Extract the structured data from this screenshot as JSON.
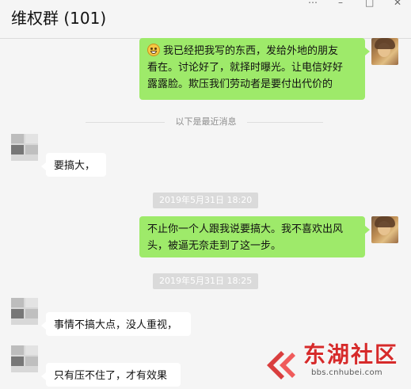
{
  "window": {
    "title": "维权群 (101)"
  },
  "chat": {
    "messages": [
      {
        "side": "self",
        "emoji": "grinning-face",
        "lines": [
          "我已经把我写的东西，发给外地的朋友",
          "看在。讨论好了，就择时曝光。让电信好好",
          "露露脸。欺压我们劳动者是要付出代价的"
        ]
      },
      {
        "type": "divider",
        "text": "以下是最近消息"
      },
      {
        "side": "other",
        "text": "要搞大，"
      },
      {
        "type": "timestamp",
        "text": "2019年5月31日 18:20"
      },
      {
        "side": "self",
        "lines": [
          "不止你一个人跟我说要搞大。我不喜欢出风",
          "头，被逼无奈走到了这一步。"
        ]
      },
      {
        "type": "timestamp",
        "text": "2019年5月31日 18:25"
      },
      {
        "side": "other",
        "text": "事情不搞大点，没人重视，"
      },
      {
        "side": "other",
        "text": "只有压不住了，才有效果"
      }
    ]
  },
  "watermark": {
    "title": "东湖社区",
    "url": "bbs.cnhubei.com",
    "accent_color": "#d62a2a"
  },
  "colors": {
    "self_bubble": "#9eea6a",
    "other_bubble": "#ffffff",
    "page_bg": "#f5f5f5"
  }
}
